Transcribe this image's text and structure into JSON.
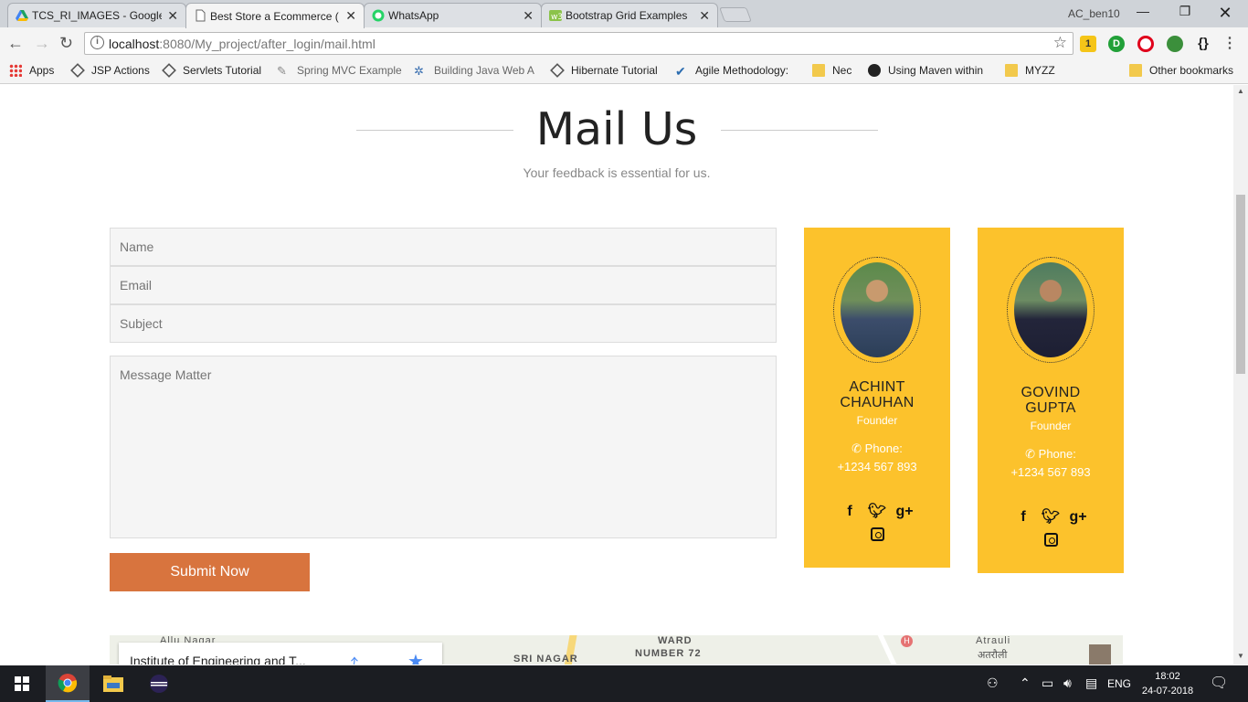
{
  "browser": {
    "tabs": [
      {
        "title": "TCS_RI_IMAGES - Google",
        "favicon": "google-drive-icon",
        "active": false
      },
      {
        "title": "Best Store a Ecommerce (",
        "favicon": "page-icon",
        "active": true
      },
      {
        "title": "WhatsApp",
        "favicon": "whatsapp-icon",
        "active": false
      },
      {
        "title": "Bootstrap Grid Examples",
        "favicon": "w3schools-icon",
        "active": false
      }
    ],
    "profile": "AC_ben10",
    "address": {
      "host": "localhost",
      "path": ":8080/My_project/after_login/mail.html"
    },
    "bookmarks": [
      {
        "label": "Apps",
        "icon": "apps-grid-icon"
      },
      {
        "label": "JSP Actions",
        "icon": "bookmark-diamond-icon"
      },
      {
        "label": "Servlets Tutorial",
        "icon": "bookmark-diamond-icon"
      },
      {
        "label": "Spring MVC Example",
        "icon": "spring-icon"
      },
      {
        "label": "Building Java Web A",
        "icon": "star-network-icon"
      },
      {
        "label": "Hibernate Tutorial",
        "icon": "bookmark-diamond-icon"
      },
      {
        "label": "Agile Methodology:",
        "icon": "check-icon"
      },
      {
        "label": "Nec",
        "icon": "folder-icon"
      },
      {
        "label": "Using Maven within",
        "icon": "eclipse-icon"
      },
      {
        "label": "MYZZ",
        "icon": "folder-icon"
      }
    ],
    "other_bookmarks": "Other bookmarks",
    "extension_badge": "1"
  },
  "page": {
    "title": "Mail Us",
    "subtitle": "Your feedback is essential for us.",
    "form": {
      "name_placeholder": "Name",
      "email_placeholder": "Email",
      "subject_placeholder": "Subject",
      "message_placeholder": "Message Matter",
      "submit_label": "Submit Now"
    },
    "team": [
      {
        "name_line1": "ACHINT",
        "name_line2": "CHAUHAN",
        "role": "Founder",
        "phone_label": "Phone:",
        "phone": "+1234 567 893"
      },
      {
        "name_line1": "GOVIND",
        "name_line2": "GUPTA",
        "role": "Founder",
        "phone_label": "Phone:",
        "phone": "+1234 567 893"
      }
    ],
    "map": {
      "place": "Institute of Engineering and T...",
      "labels": [
        "Allu Nagar",
        "SRI NAGAR",
        "WARD",
        "NUMBER 72",
        "Atrauli",
        "अतरौली"
      ]
    }
  },
  "taskbar": {
    "language": "ENG",
    "time": "18:02",
    "date": "24-07-2018"
  },
  "colors": {
    "accent_orange": "#d8743e",
    "card_yellow": "#fcc22c"
  }
}
